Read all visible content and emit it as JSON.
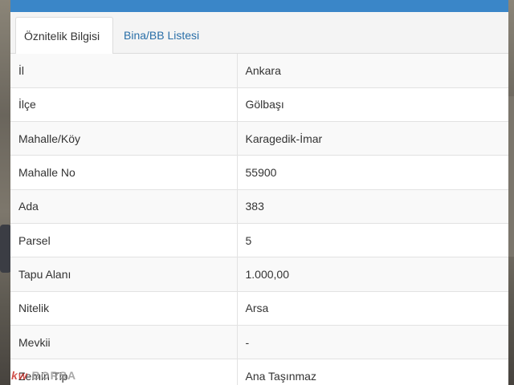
{
  "tabs": [
    {
      "label": "Öznitelik Bilgisi",
      "active": true
    },
    {
      "label": "Bina/BB Listesi",
      "active": false
    }
  ],
  "attributes": [
    {
      "key": "İl",
      "value": "Ankara"
    },
    {
      "key": "İlçe",
      "value": "Gölbaşı"
    },
    {
      "key": "Mahalle/Köy",
      "value": "Karagedik-İmar"
    },
    {
      "key": "Mahalle No",
      "value": "55900"
    },
    {
      "key": "Ada",
      "value": "383"
    },
    {
      "key": "Parsel",
      "value": "5"
    },
    {
      "key": "Tapu Alanı",
      "value": "1.000,00"
    },
    {
      "key": "Nitelik",
      "value": "Arsa"
    },
    {
      "key": "Mevkii",
      "value": "-"
    },
    {
      "key": "Zemin Tip",
      "value": "Ana Taşınmaz"
    }
  ],
  "watermark": {
    "brand": "kw",
    "text": "BORSA"
  },
  "colors": {
    "header": "#3a86c8",
    "link": "#2a6fa8",
    "watermark_brand": "#c9342f"
  }
}
